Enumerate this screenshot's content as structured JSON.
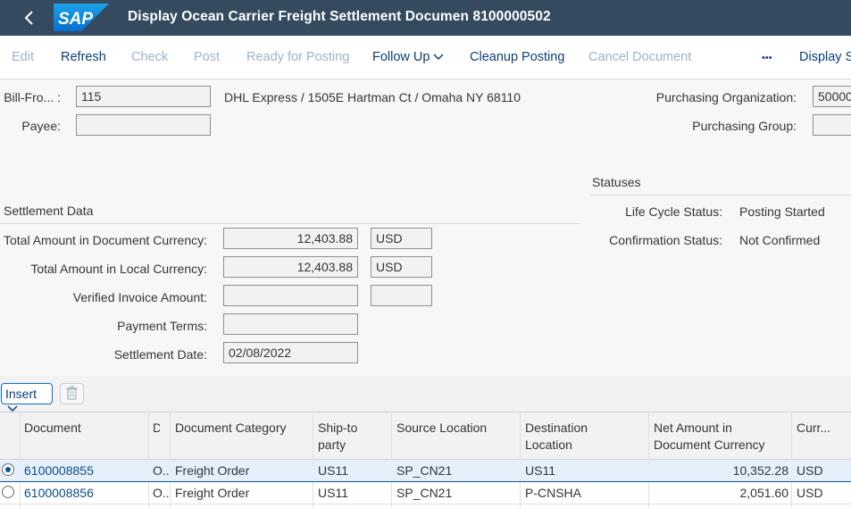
{
  "shell": {
    "logo_text": "SAP",
    "title": "Display Ocean Carrier Freight Settlement Documen 8100000502"
  },
  "toolbar": {
    "edit": "Edit",
    "refresh": "Refresh",
    "check": "Check",
    "post": "Post",
    "ready_for_posting": "Ready for Posting",
    "follow_up": "Follow Up",
    "cleanup_posting": "Cleanup Posting",
    "cancel_document": "Cancel Document",
    "more": "•••",
    "display_s": "Display S"
  },
  "header": {
    "bill_from_label": "Bill-Fro... :",
    "bill_from_value": "115",
    "bill_from_desc": "DHL Express / 1505E Hartman Ct / Omaha NY 68110",
    "payee_label": "Payee:",
    "payee_value": "",
    "purch_org_label": "Purchasing Organization:",
    "purch_org_value": "50000",
    "purch_group_label": "Purchasing Group:",
    "purch_group_value": ""
  },
  "settlement": {
    "section_title": "Settlement Data",
    "total_doc_label": "Total Amount in Document Currency:",
    "total_doc_value": "12,403.88",
    "total_doc_currency": "USD",
    "total_local_label": "Total Amount in Local Currency:",
    "total_local_value": "12,403.88",
    "total_local_currency": "USD",
    "verified_label": "Verified Invoice Amount:",
    "verified_value": "",
    "verified_currency": "",
    "payment_terms_label": "Payment Terms:",
    "payment_terms_value": "",
    "settlement_date_label": "Settlement Date:",
    "settlement_date_value": "02/08/2022"
  },
  "statuses": {
    "section_title": "Statuses",
    "lifecycle_label": "Life Cycle Status:",
    "lifecycle_value": "Posting Started",
    "confirmation_label": "Confirmation Status:",
    "confirmation_value": "Not Confirmed"
  },
  "table_toolbar": {
    "insert_label": "Insert"
  },
  "table": {
    "columns": {
      "document": "Document",
      "d": "D",
      "doc_category": "Document Category",
      "ship_to_1": "Ship-to",
      "ship_to_2": "party",
      "source_location": "Source Location",
      "dest_1": "Destination",
      "dest_2": "Location",
      "net_1": "Net Amount in",
      "net_2": "Document Currency",
      "currency": "Curr..."
    },
    "rows": [
      {
        "document": "6100008855",
        "d": "O..",
        "category": "Freight Order",
        "ship_to": "US11",
        "source": "SP_CN21",
        "destination": "US11",
        "net_amount": "10,352.28",
        "currency": "USD"
      },
      {
        "document": "6100008856",
        "d": "O..",
        "category": "Freight Order",
        "ship_to": "US11",
        "source": "SP_CN21",
        "destination": "P-CNSHA",
        "net_amount": "2,051.60",
        "currency": "USD"
      }
    ]
  },
  "colors": {
    "shell_bg": "#354a5f",
    "link": "#0a4d8c",
    "disabled": "#9fb3c8"
  }
}
